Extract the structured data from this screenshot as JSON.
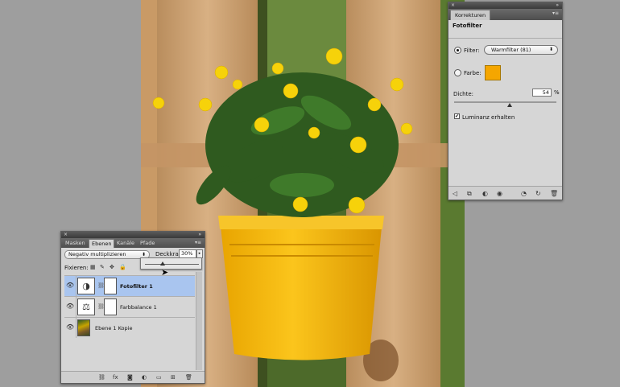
{
  "korrekturen": {
    "tab": "Korrekturen",
    "subtitle": "Fotofilter",
    "filter_label": "Filter:",
    "filter_value": "Warmfilter (81)",
    "farbe_label": "Farbe:",
    "farbe_color": "#f5a600",
    "dichte_label": "Dichte:",
    "dichte_value": "54",
    "dichte_unit": "%",
    "luminanz_label": "Luminanz erhalten",
    "luminanz_checked": true
  },
  "ebenen": {
    "tabs": [
      "Masken",
      "Ebenen",
      "Kanäle",
      "Pfade"
    ],
    "active_tab": "Ebenen",
    "blend_mode": "Negativ multiplizieren",
    "opacity_label": "Deckkraft:",
    "opacity_value": "30%",
    "fix_label": "Fixieren:",
    "layers": [
      {
        "name": "Fotofilter 1",
        "selected": true
      },
      {
        "name": "Farbbalance 1",
        "selected": false
      },
      {
        "name": "Ebene 1 Kopie",
        "selected": false
      }
    ]
  },
  "colors": {
    "pot": "#f5bb0d",
    "flower": "#f6d20a",
    "selection": "#a9c5ef"
  }
}
